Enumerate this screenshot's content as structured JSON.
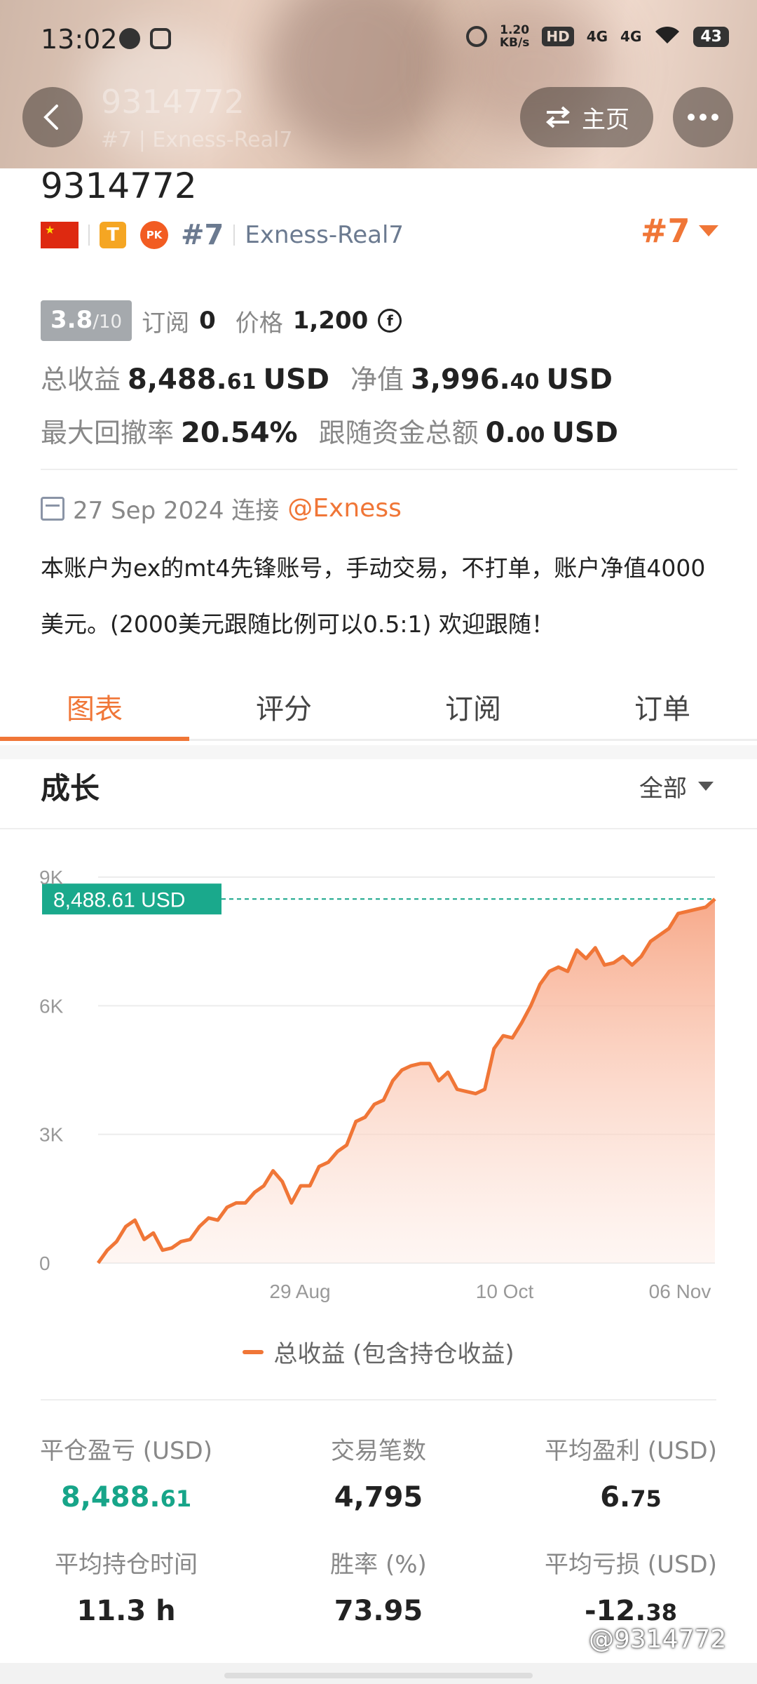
{
  "status_bar": {
    "time": "13:02",
    "net_speed_value": "1.20",
    "net_speed_unit": "KB/s",
    "hd_badge": "HD",
    "signal1": "4G",
    "signal2": "4G",
    "battery": "43"
  },
  "header": {
    "ghost_title": "9314772",
    "ghost_subtitle": "#7 | Exness-Real7",
    "home_label": "主页"
  },
  "profile": {
    "account_id": "9314772",
    "t_badge": "T",
    "pk_badge": "PK",
    "rank_small": "#7",
    "server": "Exness-Real7",
    "rank_big": "#7",
    "score": "3.8",
    "score_max": "/10",
    "subscribe_label": "订阅",
    "subscribe_value": "0",
    "price_label": "价格",
    "price_value": "1,200",
    "price_icon": "f",
    "total_profit_label": "总收益",
    "total_profit_int": "8,488.",
    "total_profit_dec": "61",
    "total_profit_unit": "USD",
    "equity_label": "净值",
    "equity_int": "3,996.",
    "equity_dec": "40",
    "equity_unit": "USD",
    "drawdown_label": "最大回撤率",
    "drawdown_value": "20.54%",
    "follow_label": "跟随资金总额",
    "follow_int": "0.",
    "follow_dec": "00",
    "follow_unit": "USD",
    "connect_date": "27 Sep 2024 连接",
    "mention": "@Exness",
    "description": "本账户为ex的mt4先锋账号，手动交易，不打单，账户净值4000美元。(2000美元跟随比例可以0.5:1) 欢迎跟随！"
  },
  "tabs": [
    {
      "label": "图表"
    },
    {
      "label": "评分"
    },
    {
      "label": "订阅"
    },
    {
      "label": "订单"
    }
  ],
  "growth": {
    "title": "成长",
    "range": "全部",
    "legend": "总收益 (包含持仓收益)"
  },
  "chart_data": {
    "type": "area",
    "y_ticks": [
      "0",
      "3K",
      "6K",
      "9K"
    ],
    "ylim": [
      0,
      9000
    ],
    "x_ticks": [
      "29 Aug",
      "10 Oct",
      "06 Nov"
    ],
    "current_label": "8,488.61 USD",
    "current_value": 8488.61,
    "series": [
      {
        "name": "总收益 (包含持仓收益)",
        "color": "#f07637",
        "values": [
          0,
          300,
          500,
          850,
          1000,
          550,
          700,
          300,
          350,
          500,
          550,
          850,
          1050,
          1000,
          1300,
          1400,
          1400,
          1650,
          1800,
          2150,
          1900,
          1400,
          1800,
          1800,
          2250,
          2350,
          2600,
          2750,
          3300,
          3400,
          3700,
          3800,
          4250,
          4500,
          4600,
          4650,
          4650,
          4250,
          4450,
          4050,
          4000,
          3950,
          4050,
          5000,
          5300,
          5250,
          5600,
          6000,
          6500,
          6800,
          6900,
          6800,
          7300,
          7100,
          7350,
          6950,
          7000,
          7150,
          6950,
          7150,
          7500,
          7650,
          7800,
          8150,
          8200,
          8250,
          8300,
          8488
        ]
      }
    ],
    "grid": true
  },
  "stats": [
    {
      "label": "平仓盈亏 (USD)",
      "int": "8,488.",
      "dec": "61",
      "green": true
    },
    {
      "label": "交易笔数",
      "int": "4,795",
      "dec": "",
      "green": false
    },
    {
      "label": "平均盈利 (USD)",
      "int": "6.",
      "dec": "75",
      "green": false
    },
    {
      "label": "平均持仓时间",
      "int": "11.3 h",
      "dec": "",
      "green": false
    },
    {
      "label": "胜率 (%)",
      "int": "73.95",
      "dec": "",
      "green": false
    },
    {
      "label": "平均亏损 (USD)",
      "int": "-12.",
      "dec": "38",
      "green": false
    }
  ],
  "watermark": "@9314772"
}
